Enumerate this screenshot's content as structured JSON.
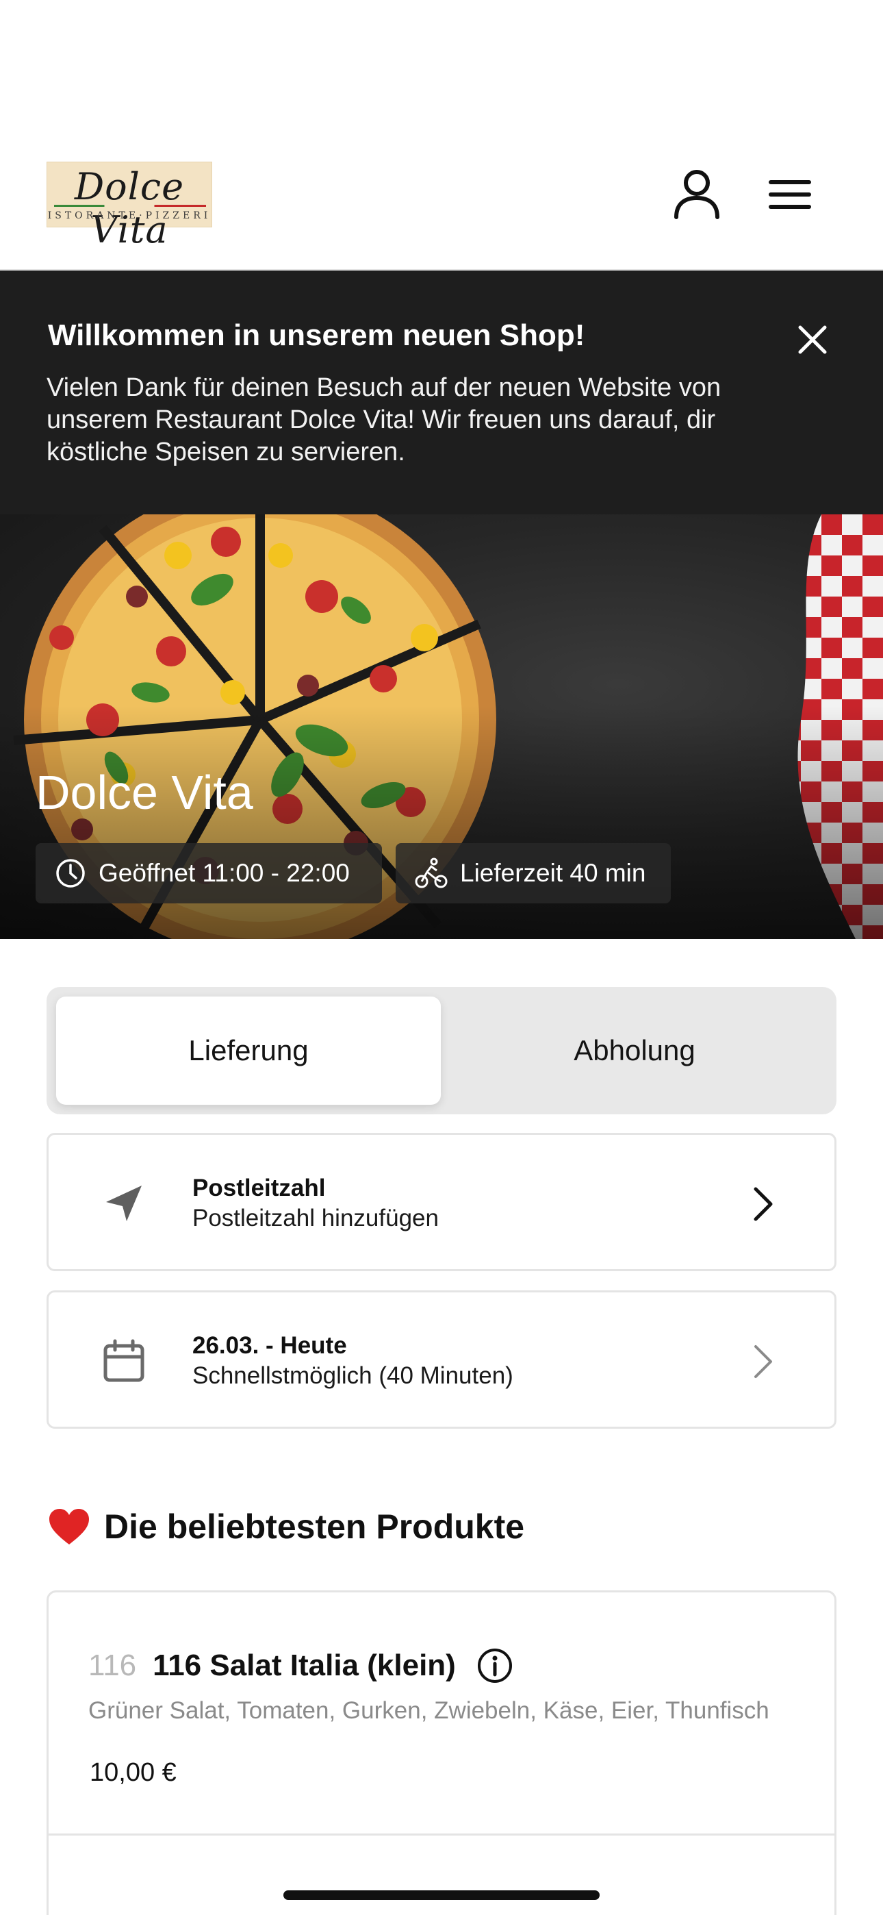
{
  "header": {
    "logo_text": "Dolce Vita",
    "logo_subtext": "ISTORANTE·PIZZERI",
    "user_icon": "user-icon",
    "menu_icon": "hamburger-menu-icon"
  },
  "banner": {
    "title": "Willkommen in unserem neuen Shop!",
    "text": "Vielen Dank für deinen Besuch auf der neuen Website von unserem Restaurant Dolce Vita! Wir freuen uns darauf, dir köstliche Speisen zu servieren.",
    "close_icon": "close-icon"
  },
  "hero": {
    "restaurant_name": "Dolce Vita",
    "opening_hours": "Geöffnet 11:00 - 22:00",
    "delivery_time": "Lieferzeit 40 min"
  },
  "order_mode": {
    "options": [
      "Lieferung",
      "Abholung"
    ],
    "selected": "Lieferung"
  },
  "zip_card": {
    "title": "Postleitzahl",
    "subtitle": "Postleitzahl hinzufügen",
    "icon": "location-arrow-icon"
  },
  "date_card": {
    "title": "26.03. - Heute",
    "subtitle": "Schnellstmöglich (40 Minuten)",
    "icon": "calendar-icon"
  },
  "popular": {
    "title": "Die beliebtesten Produkte",
    "icon": "heart-icon",
    "products": [
      {
        "number": "116",
        "name": "116 Salat Italia (klein)",
        "description": "Grüner Salat, Tomaten, Gurken, Zwiebeln, Käse, Eier, Thunfisch",
        "price": "10,00 €"
      }
    ]
  },
  "colors": {
    "banner_bg": "#1e1e1e",
    "heart": "#e02424",
    "segment_bg": "#e8e8e8"
  }
}
